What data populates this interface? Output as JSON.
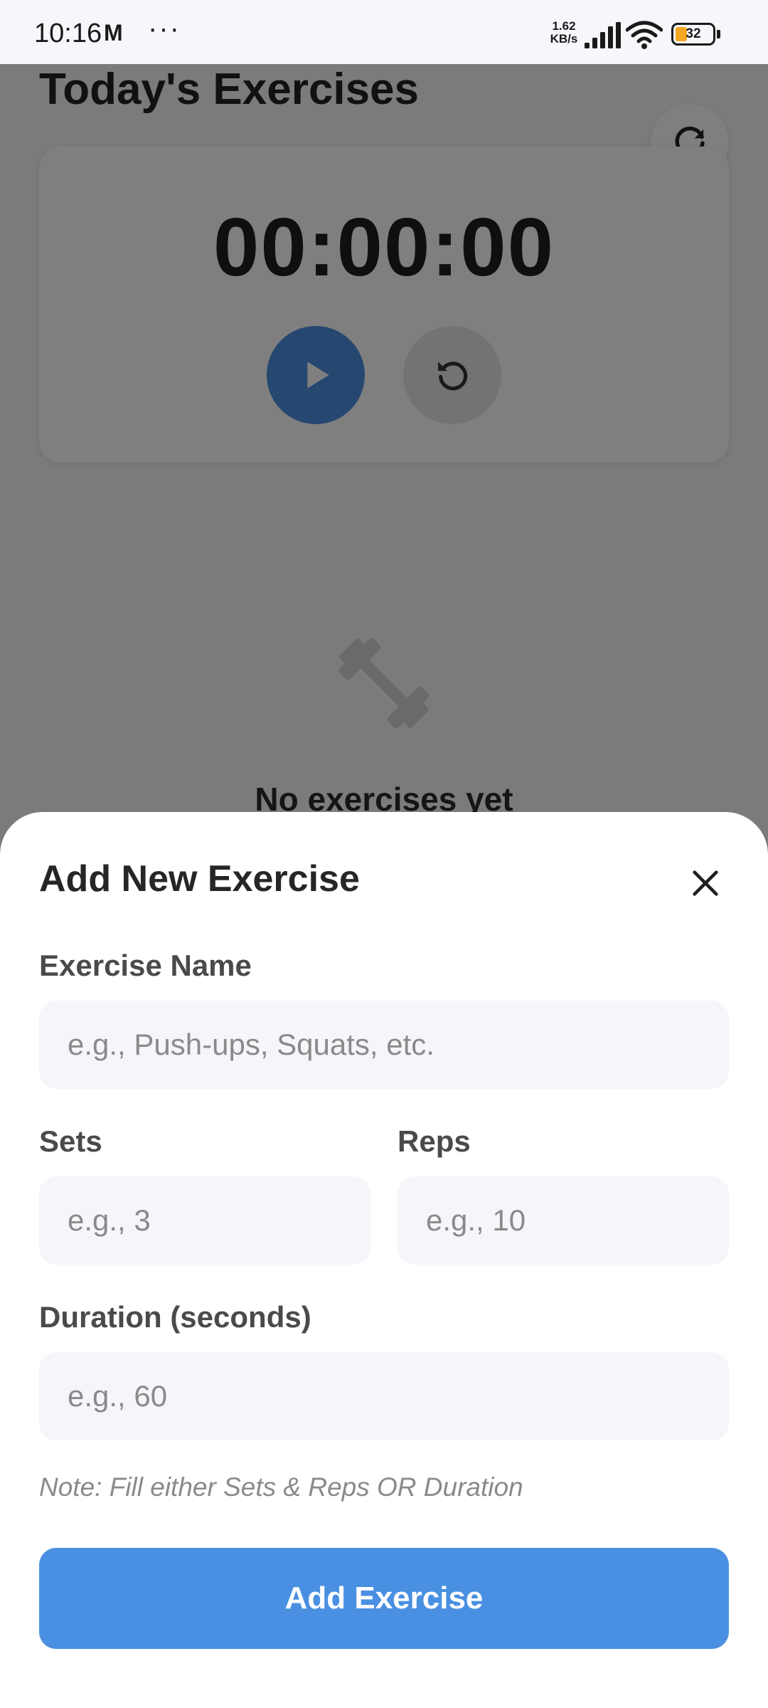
{
  "status_bar": {
    "time": "10:16",
    "carrier_glyph": "M",
    "more_glyph": "···",
    "speed_value": "1.62",
    "speed_unit": "KB/s",
    "battery": "32",
    "battery_level": 0.32,
    "battery_color": "#f5a623",
    "icons": [
      "signal-icon",
      "wifi-icon",
      "battery-icon"
    ]
  },
  "page": {
    "title": "Today's Exercises",
    "refresh_icon": "refresh-icon"
  },
  "timer": {
    "display": "00:00:00",
    "play_icon": "play-icon",
    "reset_icon": "reset-icon"
  },
  "empty_state": {
    "icon": "dumbbell-icon",
    "title": "No exercises yet"
  },
  "modal": {
    "title": "Add New Exercise",
    "close_icon": "close-icon",
    "exercise_name": {
      "label": "Exercise Name",
      "placeholder": "e.g., Push-ups, Squats, etc.",
      "value": ""
    },
    "sets": {
      "label": "Sets",
      "placeholder": "e.g., 3",
      "value": ""
    },
    "reps": {
      "label": "Reps",
      "placeholder": "e.g., 10",
      "value": ""
    },
    "duration": {
      "label": "Duration (seconds)",
      "placeholder": "e.g., 60",
      "value": ""
    },
    "note": "Note: Fill either Sets & Reps OR Duration",
    "submit_label": "Add Exercise"
  },
  "colors": {
    "accent": "#4a90e2",
    "play_button": "#4a8fe0",
    "background": "#f6f7fb",
    "input_background": "#f5f6fa"
  }
}
